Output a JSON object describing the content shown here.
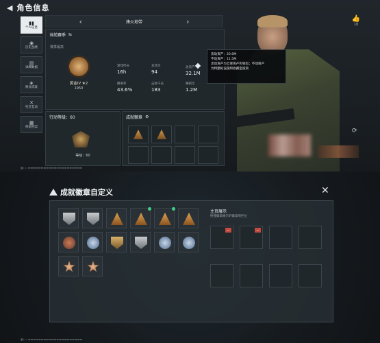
{
  "header": {
    "back_icon": "back-arrow-icon",
    "title": "角色信息"
  },
  "likes": {
    "count": "18"
  },
  "side_tabs": [
    {
      "label": "个人信息",
      "icon": "bar-chart-icon",
      "active": true
    },
    {
      "label": "历史战绩",
      "icon": "history-icon",
      "active": false
    },
    {
      "label": "详细数据",
      "icon": "list-icon",
      "active": false
    },
    {
      "label": "账号成就",
      "icon": "trophy-icon",
      "active": false
    },
    {
      "label": "社交互动",
      "icon": "social-icon",
      "active": false
    },
    {
      "label": "保留档案",
      "icon": "archive-icon",
      "active": false
    }
  ],
  "season": {
    "name": "烽火地带"
  },
  "stats": {
    "title": "当前赛季",
    "rank_section_label": "赛季最高",
    "rank_name": "黄金IV ★2",
    "rank_score": "1950",
    "items": [
      {
        "label": "游戏时长",
        "value": "16h"
      },
      {
        "label": "总场次",
        "value": "94"
      },
      {
        "label": "总资产",
        "value": "32.1M"
      },
      {
        "label": "撤离率",
        "value": "43.6%"
      },
      {
        "label": "击败干员",
        "value": "183"
      },
      {
        "label": "赚损比",
        "value": "1.2M"
      }
    ]
  },
  "tooltip": {
    "lines": [
      "流动资产：20.6M",
      "不动资产：11.5M",
      "流动资产为仓库资产和钱包；不动资产",
      "为特勤处设施和收藏室投资"
    ]
  },
  "level": {
    "title": "行动等级：60",
    "label": "等级：60"
  },
  "achievements": {
    "title": "成就徽章"
  },
  "dialog": {
    "title": "成就徽章自定义",
    "display_title": "主页展示",
    "display_hint": "拖拽徽章展示的徽章到栏位"
  },
  "colors": {
    "accent_green": "#3dd08a",
    "remove_red": "#c24a3f"
  }
}
